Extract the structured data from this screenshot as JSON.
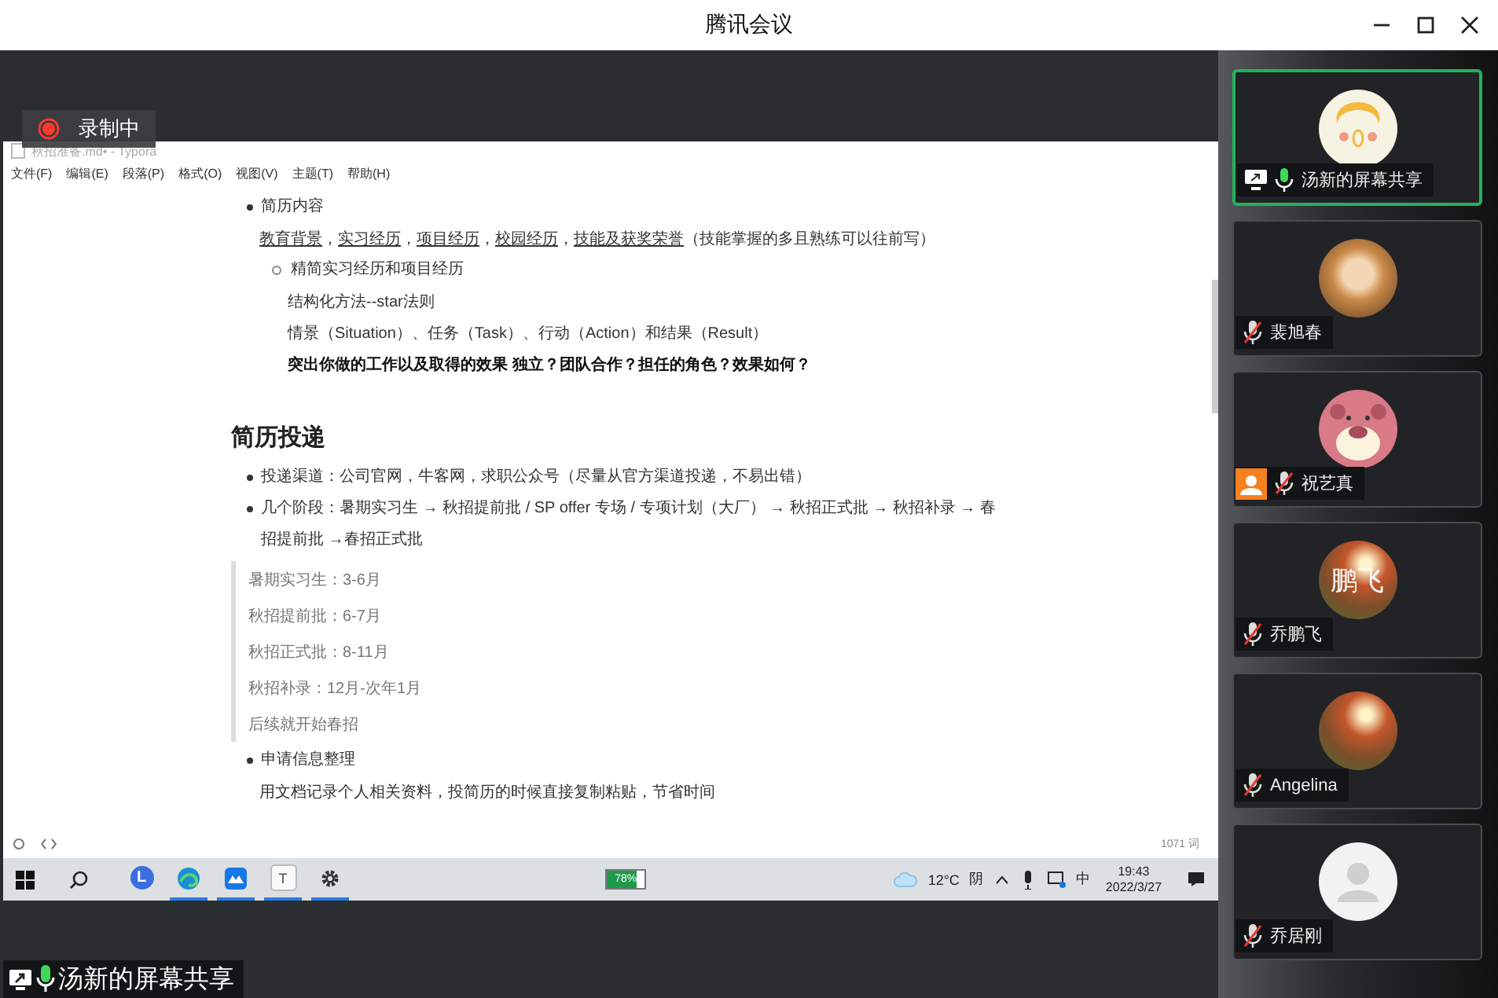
{
  "window": {
    "title": "腾讯会议"
  },
  "recording": {
    "label": "录制中"
  },
  "editor": {
    "title": "秋招准备.md• - Typora",
    "menu": [
      "文件(F)",
      "编辑(E)",
      "段落(P)",
      "格式(O)",
      "视图(V)",
      "主题(T)",
      "帮助(H)"
    ],
    "blocks": [
      {
        "kind": "bullet",
        "text": "简历内容"
      },
      {
        "kind": "links",
        "parts": [
          {
            "text": "教育背景",
            "underline": true,
            "after": "，"
          },
          {
            "text": "实习经历",
            "underline": true,
            "after": "，"
          },
          {
            "text": "项目经历",
            "underline": true,
            "after": "，"
          },
          {
            "text": "校园经历",
            "underline": true,
            "after": "，"
          },
          {
            "text": "技能及获奖荣誉",
            "underline": true
          },
          {
            "text": "（技能掌握的多且熟练可以往前写）",
            "underline": false
          }
        ]
      },
      {
        "kind": "subbullet",
        "text": "精简实习经历和项目经历"
      },
      {
        "kind": "subpara",
        "text": "结构化方法--star法则"
      },
      {
        "kind": "subpara",
        "text": "情景（Situation）、任务（Task）、行动（Action）和结果（Result）"
      },
      {
        "kind": "subbold",
        "text": "突出你做的工作以及取得的效果  独立？团队合作？担任的角色？效果如何？"
      },
      {
        "kind": "heading",
        "text": "简历投递"
      },
      {
        "kind": "bullet",
        "text": "投递渠道：公司官网，牛客网，求职公众号（尽量从官方渠道投递，不易出错）"
      },
      {
        "kind": "bullet",
        "text": "几个阶段：暑期实习生 → 秋招提前批 / SP offer 专场 / 专项计划（大厂） → 秋招正式批 → 秋招补录 → 春招提前批 →春招正式批"
      },
      {
        "kind": "quote",
        "lines": [
          "暑期实习生：3-6月",
          "秋招提前批：6-7月",
          "秋招正式批：8-11月",
          "秋招补录：12月-次年1月",
          "后续就开始春招"
        ]
      },
      {
        "kind": "bullet",
        "text": "申请信息整理"
      },
      {
        "kind": "para",
        "text": "用文档记录个人相关资料，投简历的时候直接复制粘贴，节省时间"
      }
    ],
    "word_count": "1071 词"
  },
  "taskbar": {
    "apps": [
      {
        "kind": "letter",
        "letter": "L",
        "running": false
      },
      {
        "kind": "edge",
        "running": true
      },
      {
        "kind": "cloud",
        "running": true
      },
      {
        "kind": "letter",
        "letter": "T",
        "running": true
      },
      {
        "kind": "gear",
        "running": true
      }
    ],
    "battery": {
      "label": "78%",
      "level": 0.78
    },
    "temperature": "12°C",
    "weather": "阴",
    "ime": "中",
    "time": "19:43",
    "date": "2022/3/27"
  },
  "share_label": "汤新的屏幕共享",
  "participants": [
    {
      "name": "汤新的屏幕共享",
      "kind": "cartoon",
      "sharing": true,
      "muted": false,
      "active": true,
      "person_badge": false
    },
    {
      "name": "裴旭春",
      "kind": "dog",
      "sharing": false,
      "muted": true,
      "active": false,
      "person_badge": false
    },
    {
      "name": "祝艺真",
      "kind": "bear",
      "sharing": false,
      "muted": true,
      "active": false,
      "person_badge": true
    },
    {
      "name": "乔鹏飞",
      "kind": "photo",
      "avatar_text": "鹏飞",
      "sharing": false,
      "muted": true,
      "active": false,
      "person_badge": false
    },
    {
      "name": "Angelina",
      "kind": "photo",
      "sharing": false,
      "muted": true,
      "active": false,
      "person_badge": false
    },
    {
      "name": "乔居刚",
      "kind": "default",
      "sharing": false,
      "muted": true,
      "active": false,
      "person_badge": false
    }
  ]
}
